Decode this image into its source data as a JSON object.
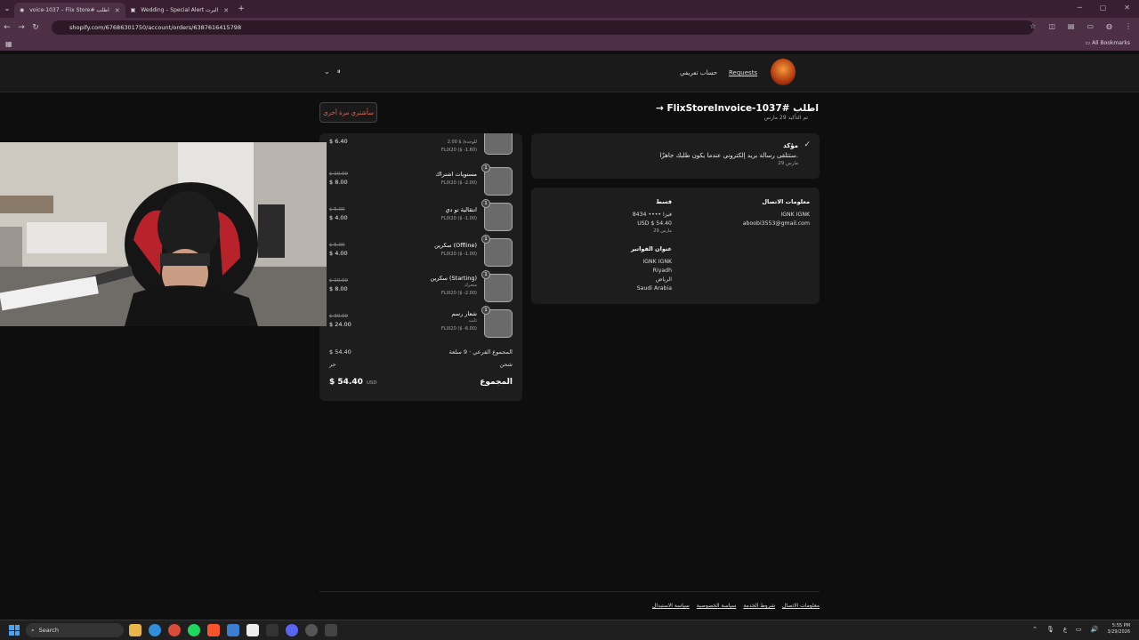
{
  "browser": {
    "tabs": [
      {
        "title": "voice-1037 – Flix Store# اطلب",
        "active": true
      },
      {
        "title": "Wedding – Special Alert البرت",
        "active": false
      }
    ],
    "url": "shopify.com/67686301750/account/orders/6387616415798",
    "bookmarks_label": "All Bookmarks"
  },
  "store_header": {
    "nav_requests": "Requests",
    "nav_account": "حساب تعريفي"
  },
  "order": {
    "title": "اطلب #FlixStoreInvoice-1037",
    "confirmed_date": "تم التأكيد 29 مارس",
    "reorder_button": "سأشتري مرة أخرى"
  },
  "status_card": {
    "title": "مؤكد",
    "message": "ستتلقى رسالة بريد إلكتروني عندما يكون طلبك جاهزًا.",
    "date": "29 مارس"
  },
  "info_card": {
    "contact_heading": "معلومات الاتصال",
    "contact_name": "IGNK IGNK",
    "contact_email": "aboobi3553@gmail.com",
    "payment_heading": "قسط",
    "payment_card": "فيزا •••• 8434",
    "payment_amount": "USD $ 54.40",
    "payment_date": "29 مارس",
    "billing_heading": "عنوان الفواتير",
    "billing_name": "IGNK IGNK",
    "billing_city": "Riyadh",
    "billing_region": "الرياض",
    "billing_country": "Saudi Arabia"
  },
  "items_partial": {
    "unit": "2.00 $ /للوحدة",
    "discount": "FLIX20 ($ -1.60)",
    "price": "$ 6.40"
  },
  "items": [
    {
      "qty": "1",
      "name": "مستويات اشتراك",
      "variant": "",
      "discount": "FLIX20 ($ -2.00)",
      "full": "$ 10.00",
      "price": "$ 8.00"
    },
    {
      "qty": "1",
      "name": "انتقالية تو دي",
      "variant": "",
      "discount": "FLIX20 ($ -1.00)",
      "full": "$ 5.00",
      "price": "$ 4.00"
    },
    {
      "qty": "1",
      "name": "سكرين (Offline)",
      "variant": "",
      "discount": "FLIX20 ($ -1.00)",
      "full": "$ 5.00",
      "price": "$ 4.00"
    },
    {
      "qty": "1",
      "name": "سكرين (Starting)",
      "variant": "متحرك",
      "discount": "FLIX20 ($ -2.00)",
      "full": "$ 10.00",
      "price": "$ 8.00"
    },
    {
      "qty": "1",
      "name": "شعار رسم",
      "variant": "ثابت",
      "discount": "FLIX20 ($ -6.00)",
      "full": "$ 30.00",
      "price": "$ 24.00"
    }
  ],
  "totals": {
    "subtotal_label": "المجموع الفرعي · 9 سلعة",
    "subtotal_value": "$ 54.40",
    "shipping_label": "شحن",
    "shipping_value": "حر",
    "total_label": "المجموع",
    "total_value": "$ 54.40",
    "currency": "USD"
  },
  "footer": {
    "links": [
      "سياسة الاستبدال",
      "سياسة الخصوصية",
      "شروط الخدمة",
      "معلومات الاتصال"
    ]
  },
  "taskbar": {
    "search_label": "Search",
    "time": "5:55 PM",
    "date": "3/29/2026"
  }
}
